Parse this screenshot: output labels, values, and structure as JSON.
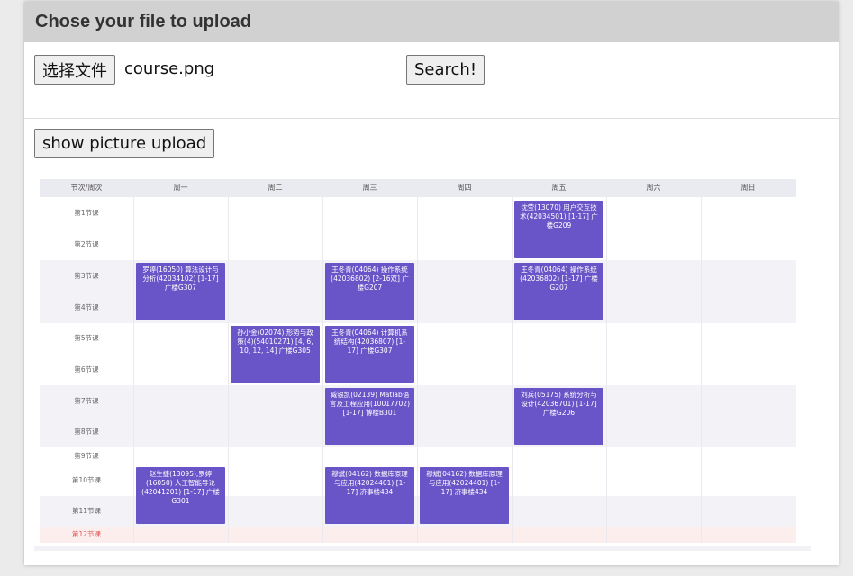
{
  "header": {
    "title": "Chose your file to upload"
  },
  "upload": {
    "choose_label": "选择文件",
    "filename": "course.png",
    "search_label": "Search!"
  },
  "show_button": {
    "label": "show picture upload"
  },
  "schedule": {
    "columns": [
      "节次/周次",
      "周一",
      "周二",
      "周三",
      "周四",
      "周五",
      "周六",
      "周日"
    ],
    "periods": [
      "第1节课",
      "第2节课",
      "第3节课",
      "第4节课",
      "第5节课",
      "第6节课",
      "第7节课",
      "第8节课",
      "第9节课",
      "第10节课",
      "第11节课",
      "第12节课"
    ],
    "courses": [
      {
        "text": "沈莹(13070) 用户交互技术(42034501) [1-17] 广楼G209"
      },
      {
        "text": "罗婷(16050) 算法设计与分析(42034102) [1-17] 广楼G307"
      },
      {
        "text": "王冬青(04064) 操作系统(42036802) [2-16双] 广楼G207"
      },
      {
        "text": "王冬青(04064) 操作系统(42036802) [1-17] 广楼G207"
      },
      {
        "text": "孙小金(02074) 形势与政策(4)(54010271) [4, 6, 10, 12, 14] 广楼G305"
      },
      {
        "text": "王冬青(04064) 计算机系统结构(42036807) [1-17] 广楼G307"
      },
      {
        "text": "臧银凯(02139) Matlab语言及工程应用(10017702) [1-17] 博楼B301"
      },
      {
        "text": "刘兵(05175) 系统分析与设计(42036701) [1-17] 广楼G206"
      },
      {
        "text": "赵生捷(13095),罗婷(16050) 人工智能导论(42041201) [1-17] 广楼G301"
      },
      {
        "text": "穆斌(04162) 数据库原理与应用(42024401) [1-17] 济事楼434"
      },
      {
        "text": "穆斌(04162) 数据库原理与应用(42024401) [1-17] 济事楼434"
      }
    ]
  },
  "colors": {
    "course_bg": "#6a55c8",
    "header_bg": "#d1d1d1",
    "highlight_row": "#fdeeee",
    "highlight_text": "#e05555"
  }
}
